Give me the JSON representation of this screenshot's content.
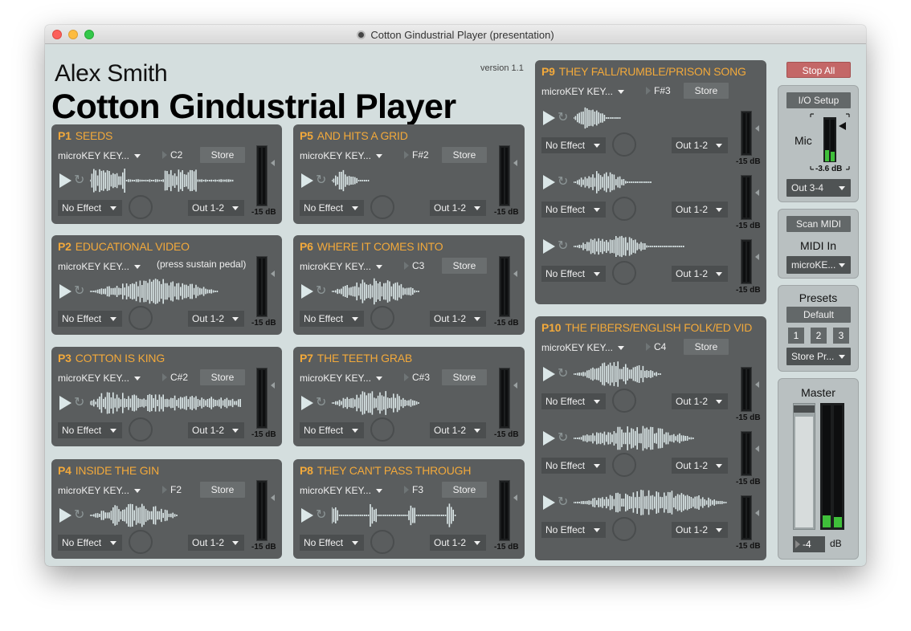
{
  "window": {
    "title": "Cotton Gindustrial Player (presentation)"
  },
  "header": {
    "author": "Alex Smith",
    "app_title": "Cotton Gindustrial Player",
    "version": "version 1.1"
  },
  "common": {
    "midi_input": "microKEY KEY...",
    "store_label": "Store",
    "effect": "No Effect",
    "output": "Out 1-2",
    "db_label": "-15 dB"
  },
  "panels": [
    {
      "num": "P1",
      "name": "SEEDS",
      "note": "C2"
    },
    {
      "num": "P2",
      "name": "EDUCATIONAL VIDEO",
      "note": "",
      "hint": "(press sustain pedal)"
    },
    {
      "num": "P3",
      "name": "COTTON IS KING",
      "note": "C#2"
    },
    {
      "num": "P4",
      "name": "INSIDE THE GIN",
      "note": "F2"
    },
    {
      "num": "P5",
      "name": "AND HITS A GRID",
      "note": "F#2"
    },
    {
      "num": "P6",
      "name": "WHERE IT COMES INTO",
      "note": "C3"
    },
    {
      "num": "P7",
      "name": "THE TEETH GRAB",
      "note": "C#3"
    },
    {
      "num": "P8",
      "name": "THEY CAN'T PASS THROUGH",
      "note": "F3"
    },
    {
      "num": "P9",
      "name": "THEY FALL/RUMBLE/PRISON SONG",
      "note": "F#3"
    },
    {
      "num": "P10",
      "name": "THE FIBERS/ENGLISH FOLK/ED VID",
      "note": "C4"
    }
  ],
  "sidebar": {
    "stop_all": "Stop All",
    "io_setup": "I/O Setup",
    "mic_label": "Mic",
    "mic_db": "-3.6 dB",
    "mic_out": "Out 3-4",
    "scan_midi": "Scan MIDI",
    "midi_in_label": "MIDI In",
    "midi_in_value": "microKE...",
    "presets_label": "Presets",
    "preset_default": "Default",
    "preset_1": "1",
    "preset_2": "2",
    "preset_3": "3",
    "store_preset": "Store Pr...",
    "master_label": "Master",
    "master_value": "-4",
    "master_unit": "dB"
  },
  "colors": {
    "accent": "#f2a93b",
    "panel": "#5a5d5e",
    "stop": "#c46767",
    "meter_green": "#3fbf3a"
  }
}
